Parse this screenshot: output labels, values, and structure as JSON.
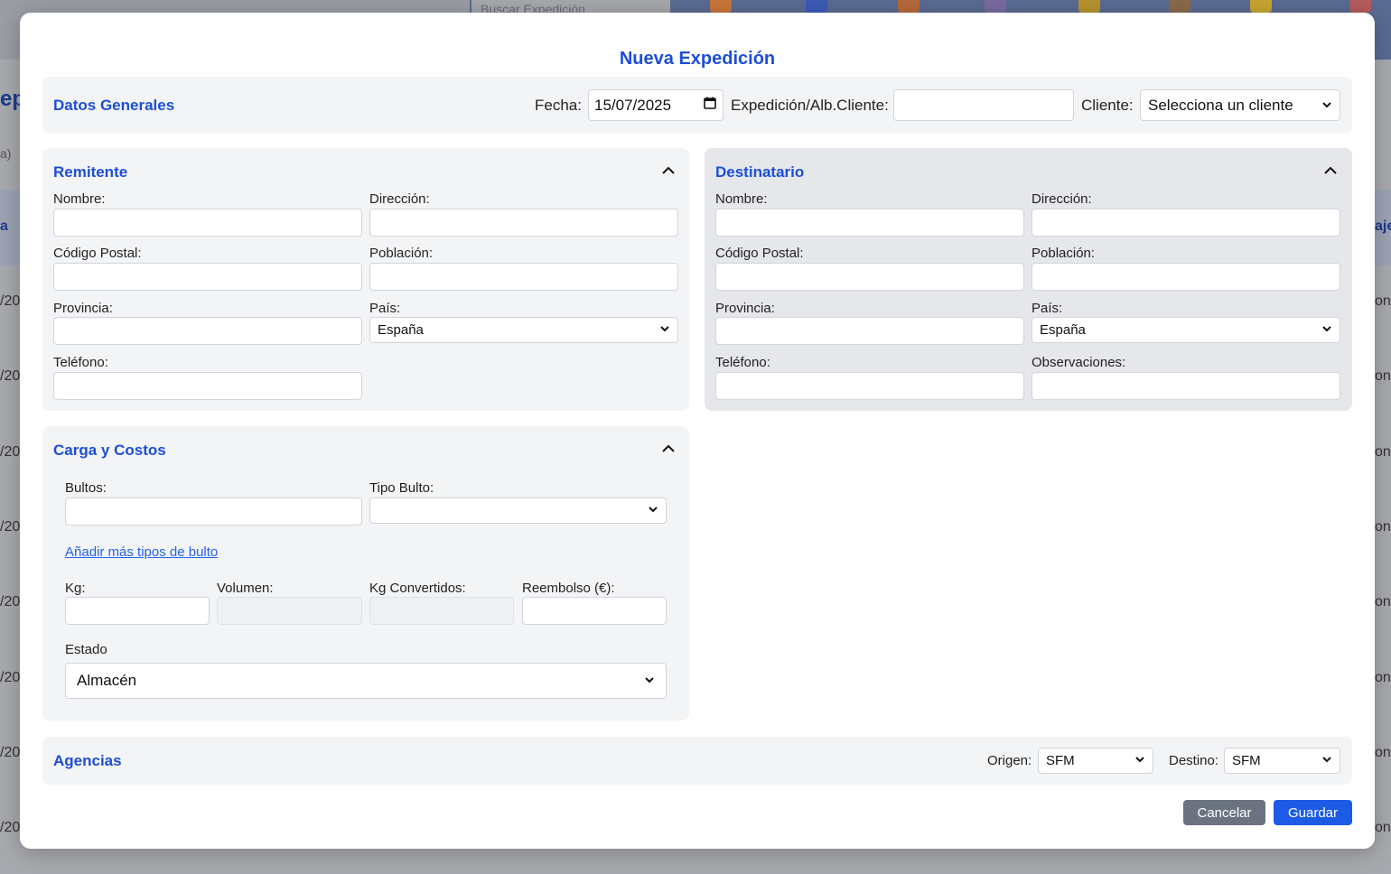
{
  "background": {
    "search_placeholder": "Buscar Expedición",
    "left_fragments": [
      "ep",
      "a)",
      "a",
      "/20",
      "/20",
      "/20",
      "/20",
      "/20",
      "/20",
      "/20",
      "/20"
    ],
    "right_fragments": [
      "aje",
      "one",
      "one",
      "one",
      "one",
      "one",
      "one",
      "one",
      "one"
    ]
  },
  "modal": {
    "title": "Nueva Expedición"
  },
  "general": {
    "title": "Datos Generales",
    "fecha_label": "Fecha:",
    "fecha_value": "15/07/2025",
    "expedicion_label": "Expedición/Alb.Cliente:",
    "expedicion_value": "",
    "cliente_label": "Cliente:",
    "cliente_value": "Selecciona un cliente"
  },
  "remitente": {
    "title": "Remitente",
    "nombre_label": "Nombre:",
    "direccion_label": "Dirección:",
    "cp_label": "Código Postal:",
    "poblacion_label": "Población:",
    "provincia_label": "Provincia:",
    "pais_label": "País:",
    "pais_value": "España",
    "telefono_label": "Teléfono:"
  },
  "destinatario": {
    "title": "Destinatario",
    "nombre_label": "Nombre:",
    "direccion_label": "Dirección:",
    "cp_label": "Código Postal:",
    "poblacion_label": "Población:",
    "provincia_label": "Provincia:",
    "pais_label": "País:",
    "pais_value": "España",
    "telefono_label": "Teléfono:",
    "observaciones_label": "Observaciones:"
  },
  "carga": {
    "title": "Carga y Costos",
    "bultos_label": "Bultos:",
    "tipo_bulto_label": "Tipo Bulto:",
    "tipo_bulto_value": "",
    "add_tipos_link": "Añadir más tipos de bulto",
    "kg_label": "Kg:",
    "volumen_label": "Volumen:",
    "kg_convertidos_label": "Kg Convertidos:",
    "reembolso_label": "Reembolso (€):",
    "estado_label": "Estado",
    "estado_value": "Almacén"
  },
  "agencias": {
    "title": "Agencias",
    "origen_label": "Origen:",
    "origen_value": "SFM",
    "destino_label": "Destino:",
    "destino_value": "SFM"
  },
  "actions": {
    "cancel_label": "Cancelar",
    "save_label": "Guardar"
  },
  "colors": {
    "accent": "#1d4ed8",
    "save_button": "#1d5be6",
    "cancel_button": "#6b7280",
    "section_bg": "#f3f4f6",
    "section_bg_dest": "#e5e7eb"
  }
}
